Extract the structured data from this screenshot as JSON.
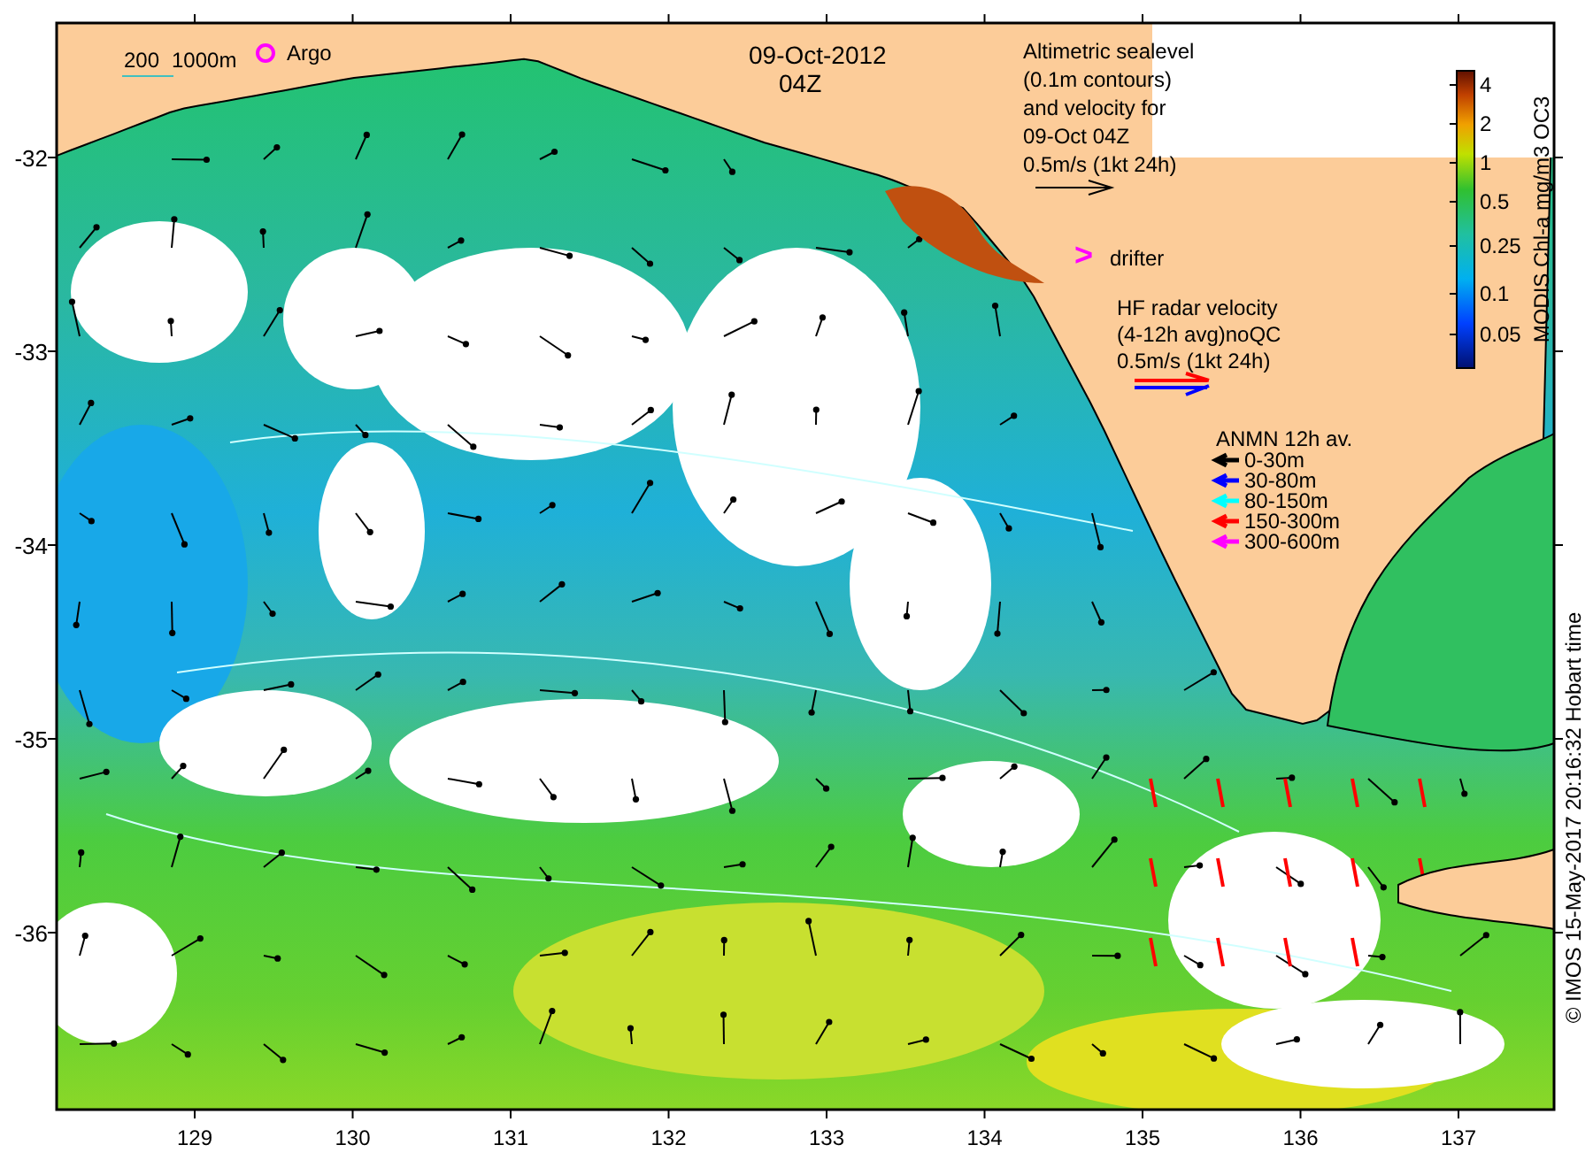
{
  "map": {
    "date": "09-Oct-2012",
    "time": "04Z",
    "scale_bar": {
      "short_label": "200",
      "long_label": "1000m"
    },
    "argo_label": "Argo",
    "altimetry_legend": [
      "Altimetric sealevel",
      "(0.1m contours)",
      "and velocity for",
      "09-Oct 04Z",
      "0.5m/s (1kt 24h)"
    ],
    "drifter_legend": {
      "symbol": ">",
      "label": "drifter"
    },
    "hf_radar_legend": [
      "HF radar velocity",
      "(4-12h avg)noQC",
      "0.5m/s (1kt 24h)"
    ],
    "anmn_legend": {
      "title": "ANMN 12h av.",
      "items": [
        {
          "label": "0-30m",
          "color": "#000000"
        },
        {
          "label": "30-80m",
          "color": "#0000ff"
        },
        {
          "label": "80-150m",
          "color": "#00ffff"
        },
        {
          "label": "150-300m",
          "color": "#ff0000"
        },
        {
          "label": "300-600m",
          "color": "#ff00ff"
        }
      ]
    },
    "colorbar": {
      "title": "MODIS Chl-a mg/m3 OC3",
      "ticks": [
        "4",
        "2",
        "1",
        "0.5",
        "0.25",
        "0.1",
        "0.05"
      ]
    },
    "credit": "© IMOS 15-May-2017 20:16:32 Hobart time",
    "y_ticks": [
      "-32",
      "-33",
      "-34",
      "-35",
      "-36"
    ],
    "x_ticks": [
      "129",
      "130",
      "131",
      "132",
      "133",
      "134",
      "135",
      "136",
      "137"
    ]
  }
}
